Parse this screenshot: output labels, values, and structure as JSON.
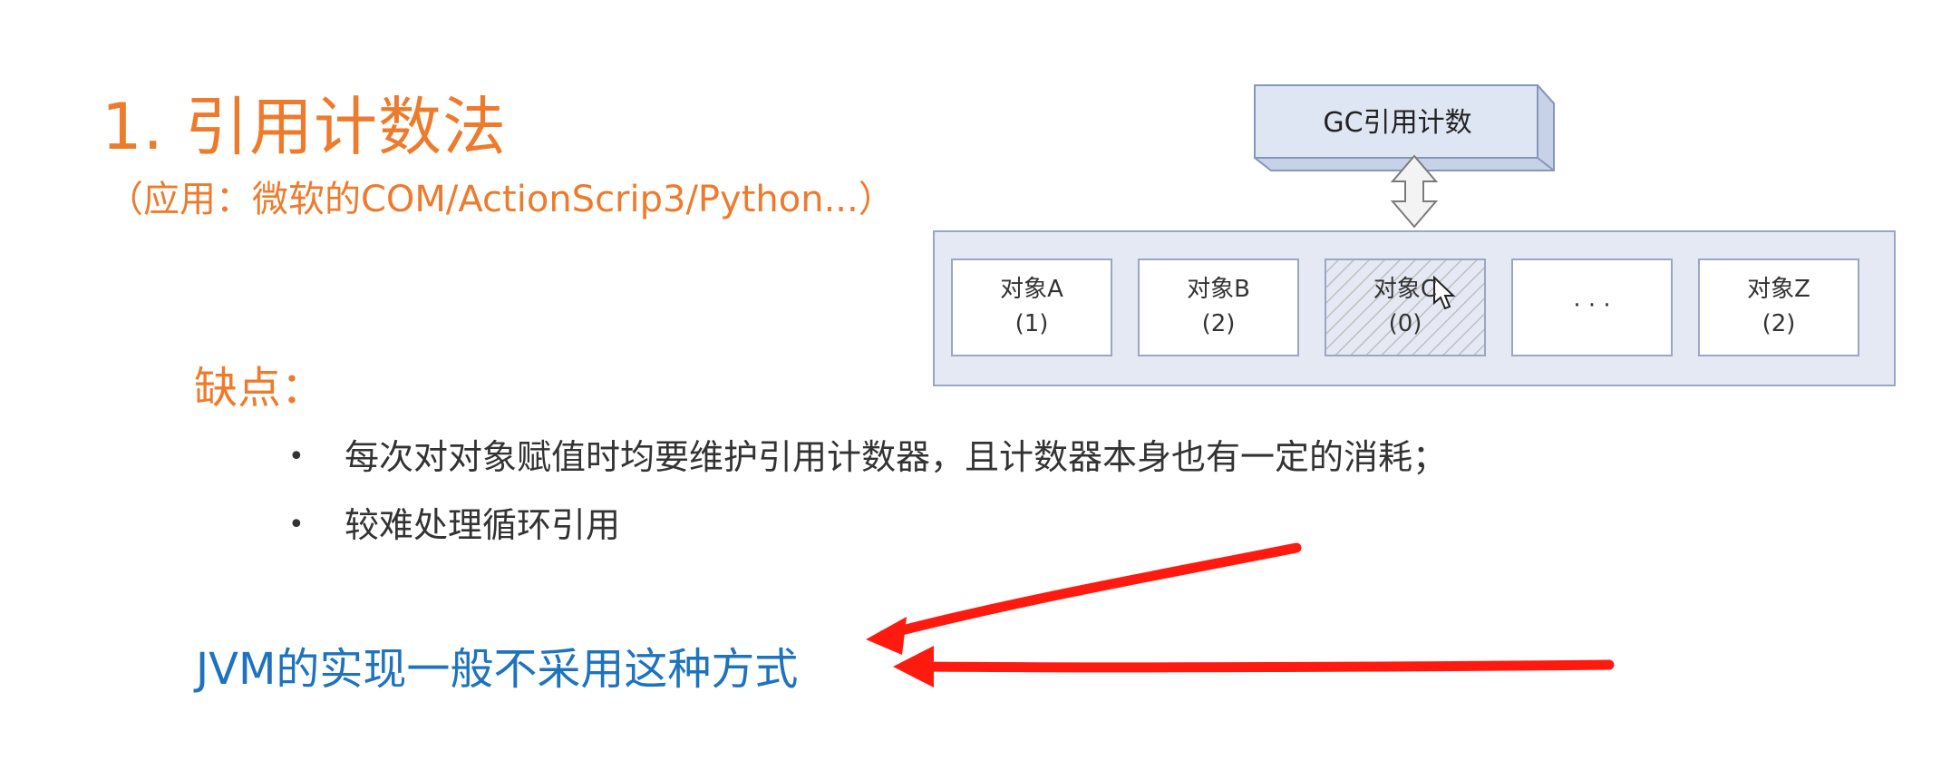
{
  "title": "1. 引用计数法",
  "subtitle": "（应用：微软的COM/ActionScrip3/Python...）",
  "cons_heading": "缺点：",
  "bullets": [
    "每次对对象赋值时均要维护引用计数器，且计数器本身也有一定的消耗；",
    "较难处理循环引用"
  ],
  "bullet_marker": "•",
  "conclusion": "JVM的实现一般不采用这种方式",
  "diagram": {
    "gc_box_label": "GC引用计数",
    "objects": [
      {
        "name": "对象A",
        "count": "(1)"
      },
      {
        "name": "对象B",
        "count": "(2)"
      },
      {
        "name": "对象C",
        "count": "(0)",
        "hatched": true
      },
      {
        "name": "· · ·",
        "count": ""
      },
      {
        "name": "对象Z",
        "count": "(2)"
      }
    ]
  },
  "colors": {
    "orange": "#ee7b2c",
    "blue": "#1e73be",
    "arrow_red": "#ff1a0f",
    "panel_fill": "#e4e9f4",
    "gc_box_fill": "#dfe6f3"
  },
  "icons": [
    "cursor-pointer-icon",
    "double-arrow-icon",
    "red-arrow-icon"
  ]
}
